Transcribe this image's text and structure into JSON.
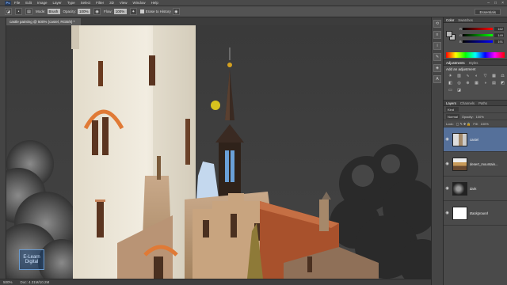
{
  "app": {
    "logo": "Ps",
    "menu": [
      "File",
      "Edit",
      "Image",
      "Layer",
      "Type",
      "Select",
      "Filter",
      "3D",
      "View",
      "Window",
      "Help"
    ]
  },
  "options": {
    "mode_label": "Mode:",
    "mode_value": "Brush",
    "opacity_label": "Opacity:",
    "opacity_value": "100%",
    "flow_label": "Flow:",
    "flow_value": "100%",
    "erase_history_label": "Erase to History",
    "workspace": "Essentials"
  },
  "document": {
    "tab_title": "castle painting @ 500% (castel, RGB/8) *",
    "zoom": "500%",
    "doc_size": "Doc: 4.31M/10.2M"
  },
  "watermark": {
    "line1": "E-Learn",
    "line2": "Digital"
  },
  "color_panel": {
    "tabs": [
      "Color",
      "Swatches"
    ],
    "r": "162",
    "g": "149",
    "b": "191",
    "colors": {
      "fg": "#b5b5b5",
      "bg": "#bfbfbf"
    }
  },
  "adjustments": {
    "tabs": [
      "Adjustments",
      "Styles"
    ],
    "title": "Add an adjustment"
  },
  "layers_panel": {
    "tabs": [
      "Layers",
      "Channels",
      "Paths"
    ],
    "kind_label": "Kind",
    "blend_mode": "Normal",
    "opacity_label": "Opacity:",
    "opacity_value": "100%",
    "lock_label": "Lock:",
    "fill_label": "Fill:",
    "fill_value": "100%",
    "layers": [
      {
        "name": "castel",
        "active": true
      },
      {
        "name": "desert_mountain...",
        "active": false
      },
      {
        "name": "dark",
        "active": false
      },
      {
        "name": "Background",
        "active": false,
        "italic": true
      }
    ]
  }
}
